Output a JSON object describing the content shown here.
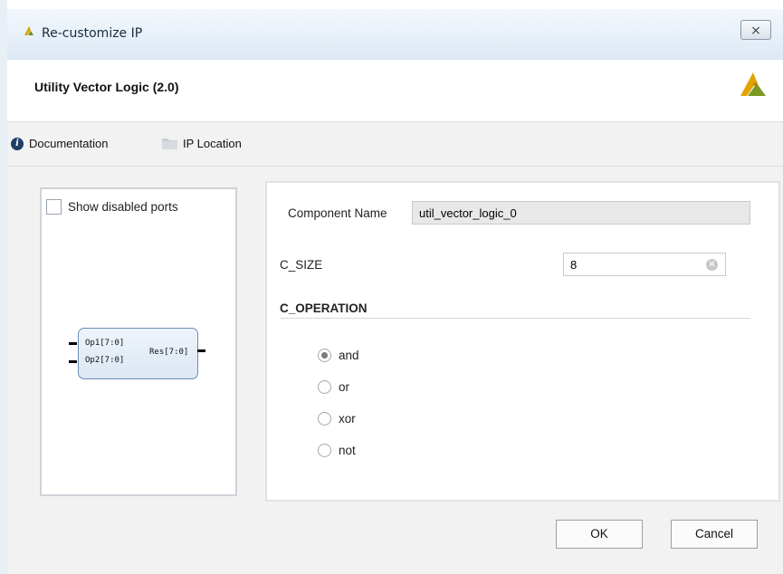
{
  "window": {
    "title": "Re-customize IP",
    "close_glyph": "⨯"
  },
  "header": {
    "ip_title": "Utility Vector Logic (2.0)"
  },
  "toolbar": {
    "documentation": "Documentation",
    "ip_location": "IP Location"
  },
  "symbol_panel": {
    "show_disabled_ports": "Show disabled ports",
    "ports_in": [
      "Op1[7:0]",
      "Op2[7:0]"
    ],
    "port_out": "Res[7:0]"
  },
  "params": {
    "component_name_label": "Component Name",
    "component_name_value": "util_vector_logic_0",
    "c_size_label": "C_SIZE",
    "c_size_value": "8",
    "c_operation_title": "C_OPERATION",
    "operations": [
      "and",
      "or",
      "xor",
      "not"
    ],
    "selected_operation": "and"
  },
  "buttons": {
    "ok": "OK",
    "cancel": "Cancel"
  }
}
